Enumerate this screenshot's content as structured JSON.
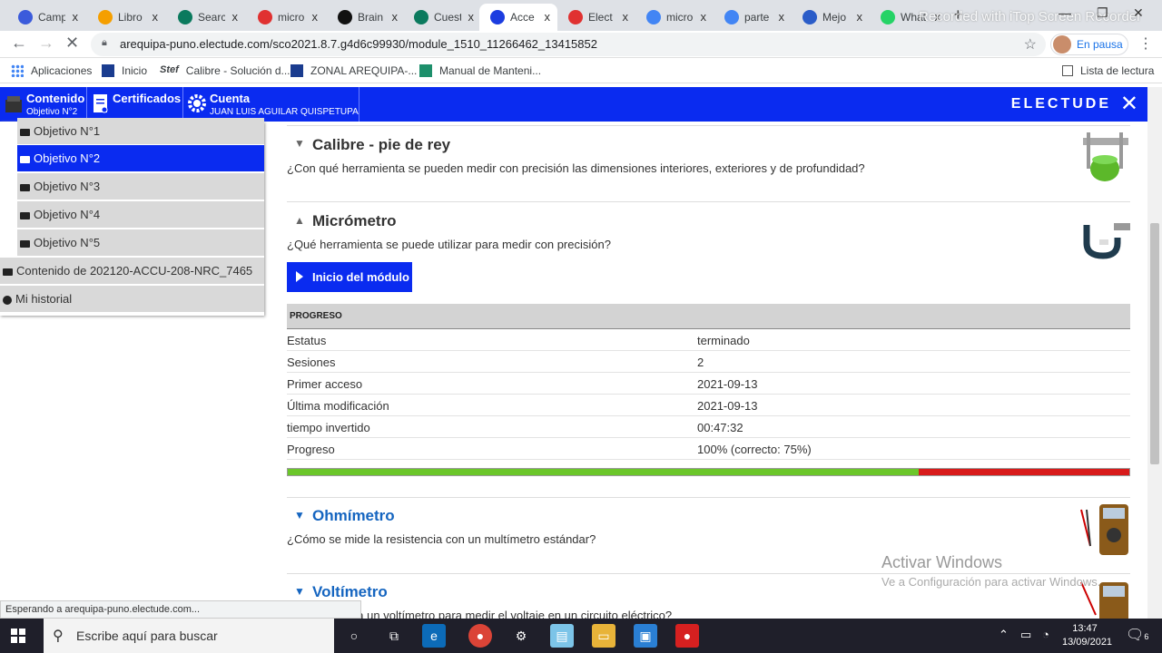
{
  "browser": {
    "tabs": [
      {
        "title": "Camp",
        "color": "#3b5bdb"
      },
      {
        "title": "Libro",
        "color": "#f59f00"
      },
      {
        "title": "Searc",
        "color": "#0b7a5e"
      },
      {
        "title": "micro",
        "color": "#e03131"
      },
      {
        "title": "Brain",
        "color": "#111111"
      },
      {
        "title": "Cuest",
        "color": "#0b7a5e"
      },
      {
        "title": "Acce",
        "color": "#1c3de0"
      },
      {
        "title": "Elect",
        "color": "#e03131"
      },
      {
        "title": "micro",
        "color": "#4285f4"
      },
      {
        "title": "parte",
        "color": "#4285f4"
      },
      {
        "title": "Mejo",
        "color": "#2a5cc8"
      },
      {
        "title": "What",
        "color": "#25d366"
      }
    ],
    "tab_close": "x",
    "new_tab": "+",
    "recorder_overlay": "Recorded with iTop Screen Recorder",
    "url": "arequipa-puno.electude.com/sco2021.8.7.g4d6c99930/module_1510_11266462_13415852",
    "profile_status": "En pausa",
    "bookmarks": [
      {
        "label": "Aplicaciones"
      },
      {
        "label": "Inicio"
      },
      {
        "label": "Calibre - Solución d..."
      },
      {
        "label": "ZONAL AREQUIPA-..."
      },
      {
        "label": "Manual de Manteni..."
      }
    ],
    "reading_list": "Lista de lectura",
    "status_text": "Esperando a arequipa-puno.electude.com..."
  },
  "app": {
    "nav": [
      {
        "title": "Contenido",
        "subtitle": "Objetivo N°2"
      },
      {
        "title": "Certificados",
        "subtitle": ""
      },
      {
        "title": "Cuenta",
        "subtitle": "JUAN LUIS AGUILAR QUISPETUPA"
      }
    ],
    "brand": "ELECTUDE",
    "close": "✕",
    "sidebar": [
      {
        "label": "Objetivo N°1"
      },
      {
        "label": "Objetivo N°2"
      },
      {
        "label": "Objetivo N°3"
      },
      {
        "label": "Objetivo N°4"
      },
      {
        "label": "Objetivo N°5"
      },
      {
        "label": "Contenido de 202120-ACCU-208-NRC_7465"
      },
      {
        "label": "Mi historial"
      }
    ],
    "modules": [
      {
        "title": "Calibre - pie de rey",
        "desc": "¿Con qué herramienta se pueden medir con precisión las dimensiones interiores, exteriores y de profundidad?",
        "color": "#666666",
        "icon": "caliper-icon"
      },
      {
        "title": "Micrómetro",
        "desc": "¿Qué herramienta se puede utilizar para medir con precisión?",
        "color": "#666666",
        "icon": "micrometer-icon"
      },
      {
        "title": "Ohmímetro",
        "desc": "¿Cómo se mide la resistencia con un multímetro estándar?",
        "color": "#1565c0",
        "icon": "multimeter-icon"
      },
      {
        "title": "Voltímetro",
        "desc": "¿Cómo se usa un voltímetro para medir el voltaje en un circuito eléctrico?",
        "color": "#1565c0",
        "icon": "voltmeter-icon"
      }
    ],
    "start_button": "Inicio del módulo",
    "progress": {
      "header": "PROGRESO",
      "rows": [
        {
          "k": "Estatus",
          "v": "terminado"
        },
        {
          "k": "Sesiones",
          "v": "2"
        },
        {
          "k": "Primer acceso",
          "v": "2021-09-13"
        },
        {
          "k": "Última modificación",
          "v": "2021-09-13"
        },
        {
          "k": "tiempo invertido",
          "v": "00:47:32"
        },
        {
          "k": "Progreso",
          "v": "100% (correcto: 75%)"
        }
      ],
      "correct_fraction": 0.75
    }
  },
  "windows": {
    "activate_title": "Activar Windows",
    "activate_sub": "Ve a Configuración para activar Windows.",
    "search_placeholder": "Escribe aquí para buscar",
    "time": "13:47",
    "date": "13/09/2021",
    "notifications": "6"
  }
}
